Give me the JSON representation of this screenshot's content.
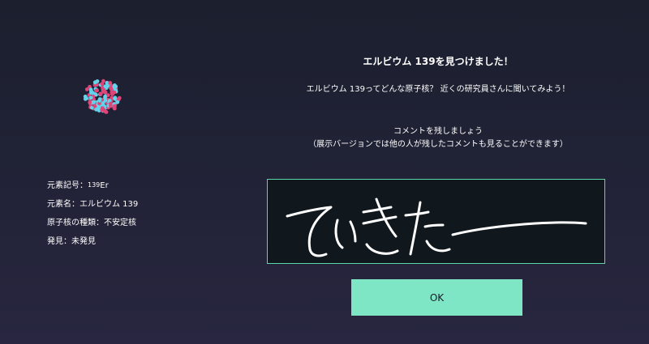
{
  "element": {
    "symbol_mass": "139",
    "symbol_label": "元素記号：",
    "symbol": "Er",
    "name_line": "元素名：エルビウム 139",
    "type_line": "原子核の種類：不安定核",
    "discovery_line": "発見：未発見"
  },
  "dialog": {
    "title": "エルビウム 139を見つけました！",
    "subtitle": "エルビウム 139ってどんな原子核？ 近くの研究員さんに聞いてみよう！",
    "comment_prompt": "コメントを残しましょう",
    "comment_note": "（展示バージョンでは他の人が残したコメントも見ることができます）",
    "ok_label": "OK"
  },
  "colors": {
    "accent": "#7ee6c4",
    "canvas_border": "#5bd6a6",
    "proton": "#e0457a",
    "neutron": "#5fd4ea"
  },
  "drawing_icon": "handwritten-comment-strokes"
}
